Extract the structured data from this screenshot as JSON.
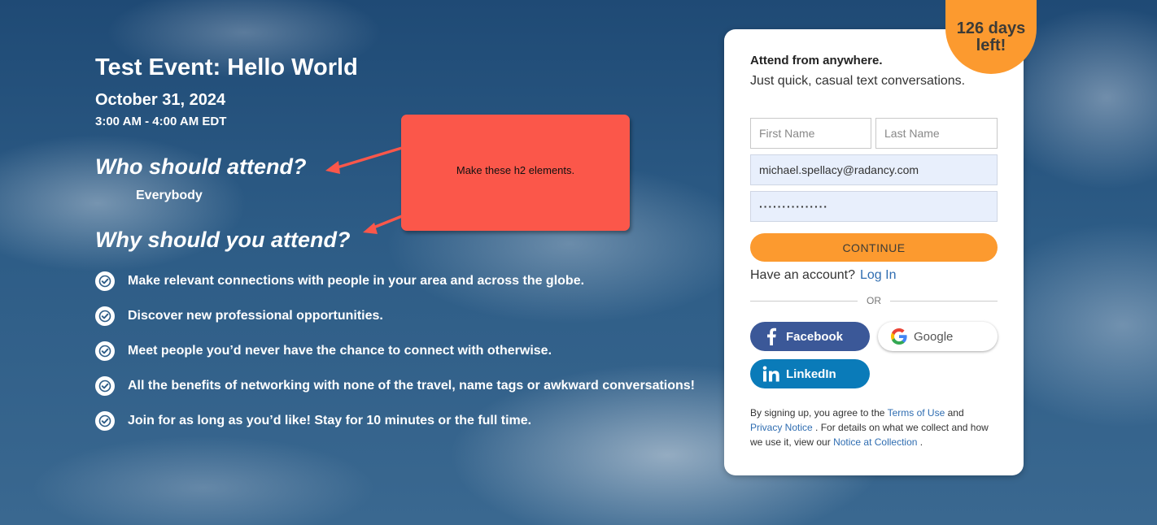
{
  "event": {
    "title": "Test Event: Hello World",
    "date": "October 31, 2024",
    "time": "3:00 AM - 4:00 AM EDT",
    "who_heading": "Who should attend?",
    "who_value": "Everybody",
    "why_heading": "Why should you attend?",
    "benefits": [
      "Make relevant connections with people in your area and across the globe.",
      "Discover new professional opportunities.",
      "Meet people you’d never have the chance to connect with otherwise.",
      "All the benefits of networking with none of the travel, name tags or awkward conversations!",
      "Join for as long as you’d like! Stay for 10 minutes or the full time."
    ]
  },
  "annotation": {
    "note_text": "Make these h2 elements."
  },
  "badge": {
    "line1": "126 days",
    "line2": "left!"
  },
  "signup": {
    "headline": "Attend from anywhere.",
    "subhead": "Just quick, casual text conversations.",
    "first_name_placeholder": "First Name",
    "last_name_placeholder": "Last Name",
    "email_value": "michael.spellacy@radancy.com",
    "password_value": "···············",
    "continue_label": "CONTINUE",
    "have_account_text": "Have an account?",
    "login_label": "Log In",
    "or_text": "OR",
    "facebook_label": "Facebook",
    "google_label": "Google",
    "linkedin_label": "LinkedIn",
    "legal": {
      "t1": "By signing up, you agree to the",
      "terms_link": "Terms of Use",
      "t2": "and",
      "privacy_link": "Privacy Notice",
      "t3": ". For details on what we collect and how we use it, view our",
      "collection_link": "Notice at Collection",
      "t4": "."
    }
  },
  "colors": {
    "accent_orange": "#fc9a2f",
    "note_red": "#fb574a",
    "facebook_blue": "#3b5898",
    "linkedin_blue": "#0a7bb9",
    "link_blue": "#2f6db1",
    "autofill_bg": "#e8effc"
  },
  "icons": [
    "check-circle-icon",
    "facebook-icon",
    "google-icon",
    "linkedin-icon",
    "arrow-icon"
  ]
}
